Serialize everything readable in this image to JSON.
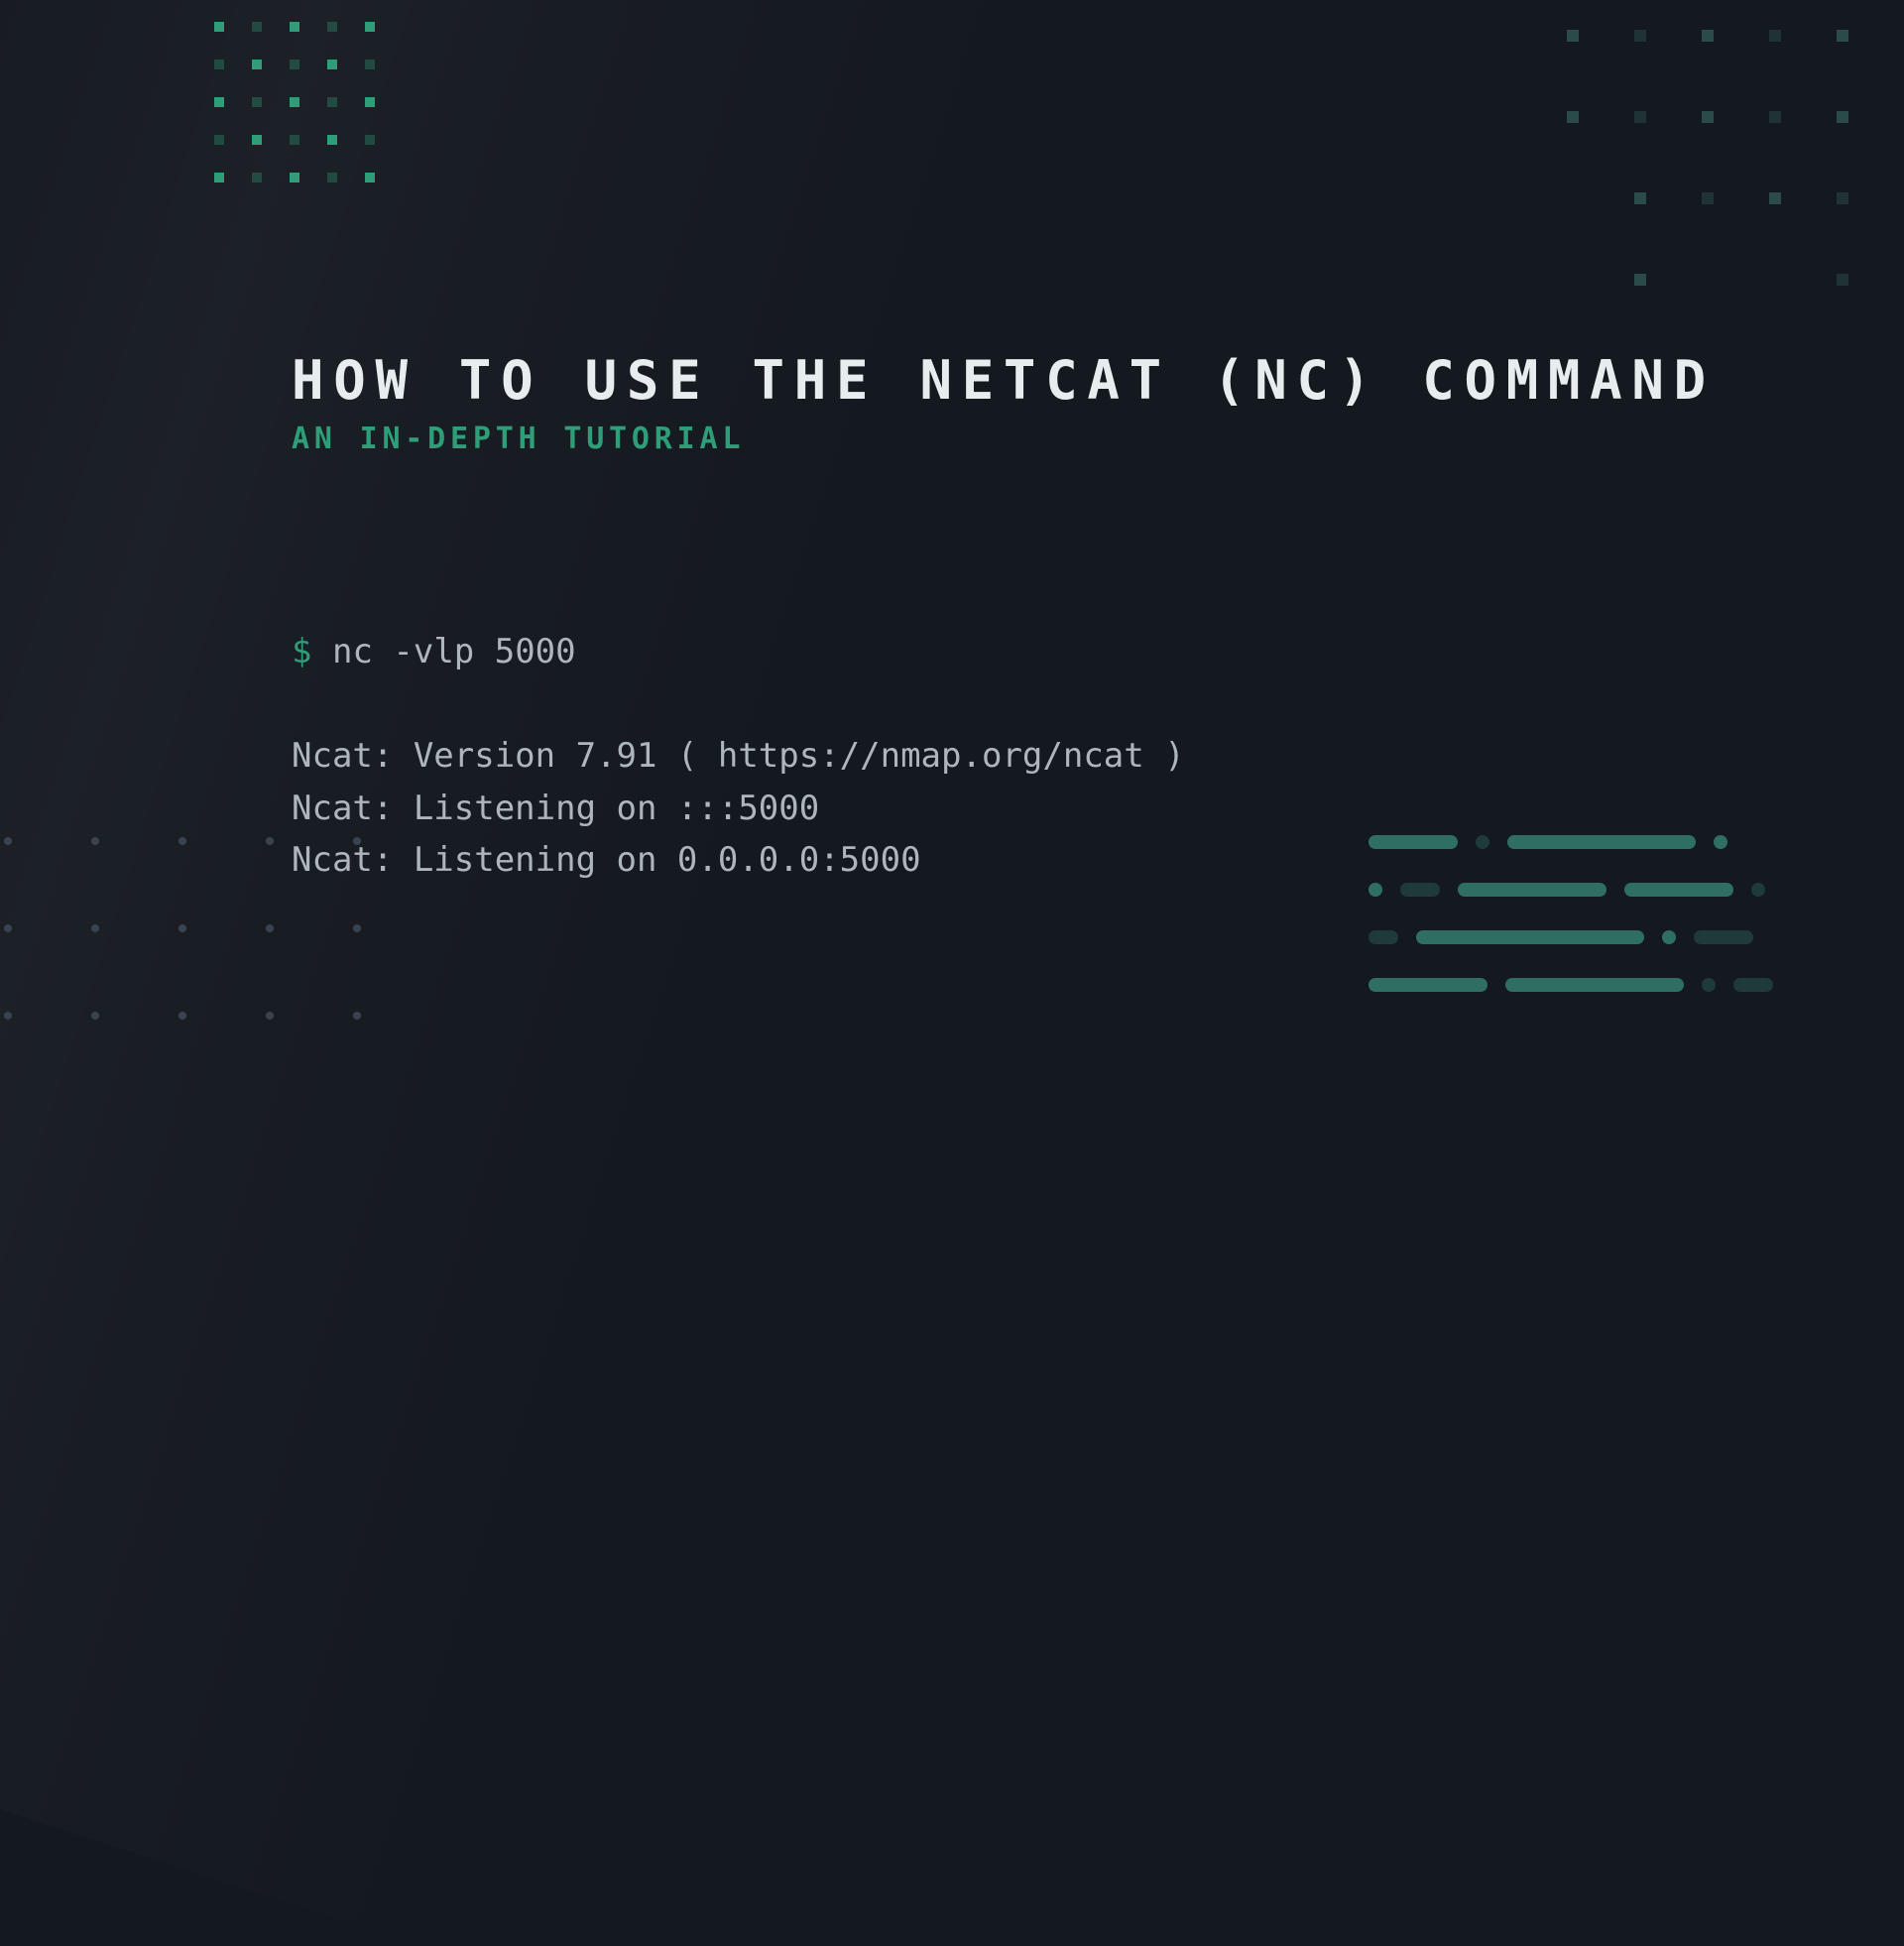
{
  "title": "HOW TO USE THE NETCAT (NC) COMMAND",
  "subtitle": "AN IN-DEPTH TUTORIAL",
  "terminal": {
    "prompt": "$",
    "command": "nc -vlp 5000",
    "output": [
      "Ncat: Version 7.91 ( https://nmap.org/ncat )",
      "Ncat: Listening on :::5000",
      "Ncat: Listening on 0.0.0.0:5000"
    ]
  },
  "colors": {
    "background": "#14181f",
    "accent": "#2f9e78",
    "text": "#e7ecef",
    "muted": "#aeb6bd",
    "decoration": "#2e6f62"
  }
}
